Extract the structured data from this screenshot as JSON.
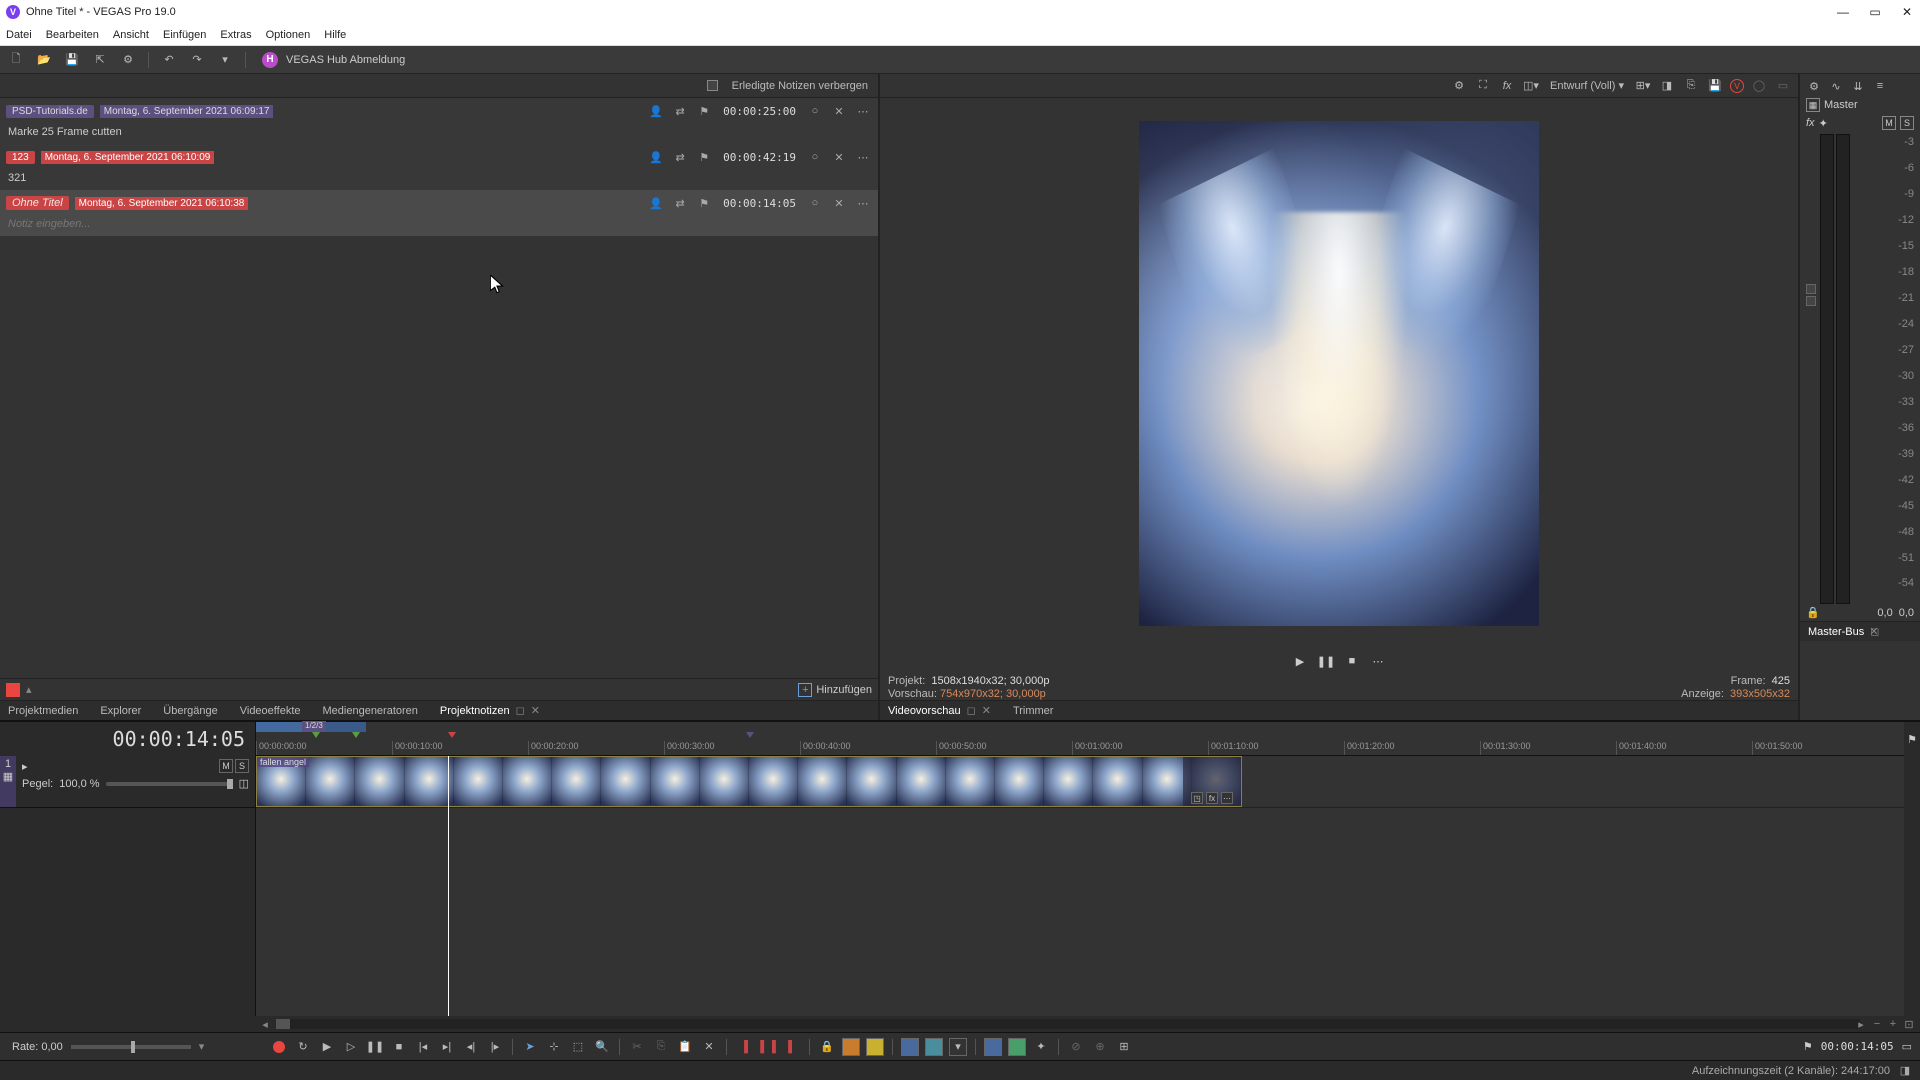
{
  "window": {
    "title": "Ohne Titel * - VEGAS Pro 19.0",
    "app_letter": "V"
  },
  "menu": [
    "Datei",
    "Bearbeiten",
    "Ansicht",
    "Einfügen",
    "Extras",
    "Optionen",
    "Hilfe"
  ],
  "toolbar": {
    "hub_letter": "H",
    "hub_label": "VEGAS Hub Abmeldung"
  },
  "notes_header": {
    "hide_done": "Erledigte Notizen verbergen"
  },
  "preview_header": {
    "quality": "Entwurf (Voll)",
    "v_letter": "V"
  },
  "notes": [
    {
      "tag": "PSD-Tutorials.de",
      "tag_style": "purple",
      "date": "Montag, 6. September 2021 06:09:17",
      "time": "00:00:25:00",
      "body": "Marke 25 Frame cutten",
      "selected": false
    },
    {
      "tag": "123",
      "tag_style": "red",
      "date": "Montag, 6. September 2021 06:10:09",
      "time": "00:00:42:19",
      "body": "321",
      "selected": false
    },
    {
      "tag": "Ohne Titel",
      "tag_italic": true,
      "tag_style": "red",
      "date": "Montag, 6. September 2021 06:10:38",
      "time": "00:00:14:05",
      "body_placeholder": "Notiz eingeben...",
      "selected": true
    }
  ],
  "left_bottom": {
    "add_label": "Hinzufügen"
  },
  "left_tabs": [
    "Projektmedien",
    "Explorer",
    "Übergänge",
    "Videoeffekte",
    "Mediengeneratoren",
    "Projektnotizen"
  ],
  "left_tabs_active": 5,
  "preview_info": {
    "projekt_lbl": "Projekt:",
    "projekt_val": "1508x1940x32; 30,000p",
    "vorschau_lbl": "Vorschau:",
    "vorschau_val": "754x970x32; 30,000p",
    "frame_lbl": "Frame:",
    "frame_val": "425",
    "anzeige_lbl": "Anzeige:",
    "anzeige_val": "393x505x32"
  },
  "center_tabs": {
    "videovorschau": "Videovorschau",
    "trimmer": "Trimmer"
  },
  "master": {
    "title": "Master",
    "fx": "fx",
    "gear": "⚙",
    "m": "M",
    "s": "S",
    "scale": [
      "-3",
      "-6",
      "-9",
      "-12",
      "-15",
      "-18",
      "-21",
      "-24",
      "-27",
      "-30",
      "-33",
      "-36",
      "-39",
      "-42",
      "-45",
      "-48",
      "-51",
      "-54"
    ],
    "zero_l": "0,0",
    "zero_r": "0,0",
    "bus_tab": "Master-Bus"
  },
  "timeline": {
    "timecode": "00:00:14:05",
    "region_label": "1/2/3",
    "ruler": [
      "00:00:00:00",
      "00:00:10:00",
      "00:00:20:00",
      "00:00:30:00",
      "00:00:40:00",
      "00:00:50:00",
      "00:01:00:00",
      "00:01:10:00",
      "00:01:20:00",
      "00:01:30:00",
      "00:01:40:00",
      "00:01:50:00"
    ],
    "track_num": "1",
    "pegel_lbl": "Pegel:",
    "pegel_val": "100,0 %",
    "m": "M",
    "s": "S",
    "clip_label": "fallen angel",
    "clip_fx": "fx"
  },
  "bottom": {
    "rate_lbl": "Rate: 0,00",
    "tc": "00:00:14:05"
  },
  "status": "Aufzeichnungszeit (2 Kanäle): 244:17:00"
}
